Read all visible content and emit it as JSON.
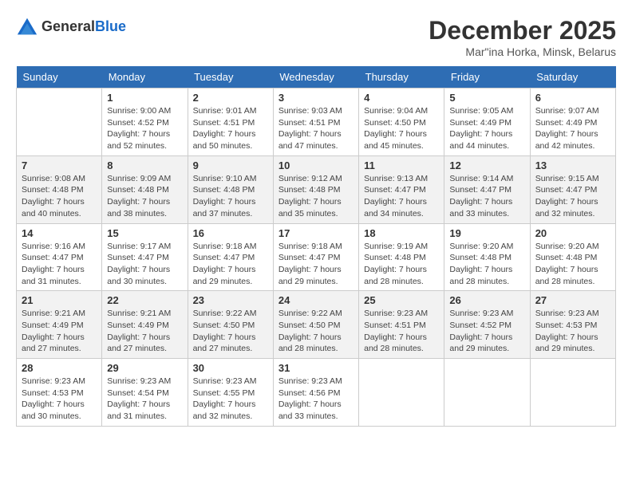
{
  "header": {
    "logo_general": "General",
    "logo_blue": "Blue",
    "title": "December 2025",
    "subtitle": "Mar\"ina Horka, Minsk, Belarus"
  },
  "days_of_week": [
    "Sunday",
    "Monday",
    "Tuesday",
    "Wednesday",
    "Thursday",
    "Friday",
    "Saturday"
  ],
  "weeks": [
    [
      {
        "day": "",
        "info": ""
      },
      {
        "day": "1",
        "info": "Sunrise: 9:00 AM\nSunset: 4:52 PM\nDaylight: 7 hours\nand 52 minutes."
      },
      {
        "day": "2",
        "info": "Sunrise: 9:01 AM\nSunset: 4:51 PM\nDaylight: 7 hours\nand 50 minutes."
      },
      {
        "day": "3",
        "info": "Sunrise: 9:03 AM\nSunset: 4:51 PM\nDaylight: 7 hours\nand 47 minutes."
      },
      {
        "day": "4",
        "info": "Sunrise: 9:04 AM\nSunset: 4:50 PM\nDaylight: 7 hours\nand 45 minutes."
      },
      {
        "day": "5",
        "info": "Sunrise: 9:05 AM\nSunset: 4:49 PM\nDaylight: 7 hours\nand 44 minutes."
      },
      {
        "day": "6",
        "info": "Sunrise: 9:07 AM\nSunset: 4:49 PM\nDaylight: 7 hours\nand 42 minutes."
      }
    ],
    [
      {
        "day": "7",
        "info": "Sunrise: 9:08 AM\nSunset: 4:48 PM\nDaylight: 7 hours\nand 40 minutes."
      },
      {
        "day": "8",
        "info": "Sunrise: 9:09 AM\nSunset: 4:48 PM\nDaylight: 7 hours\nand 38 minutes."
      },
      {
        "day": "9",
        "info": "Sunrise: 9:10 AM\nSunset: 4:48 PM\nDaylight: 7 hours\nand 37 minutes."
      },
      {
        "day": "10",
        "info": "Sunrise: 9:12 AM\nSunset: 4:48 PM\nDaylight: 7 hours\nand 35 minutes."
      },
      {
        "day": "11",
        "info": "Sunrise: 9:13 AM\nSunset: 4:47 PM\nDaylight: 7 hours\nand 34 minutes."
      },
      {
        "day": "12",
        "info": "Sunrise: 9:14 AM\nSunset: 4:47 PM\nDaylight: 7 hours\nand 33 minutes."
      },
      {
        "day": "13",
        "info": "Sunrise: 9:15 AM\nSunset: 4:47 PM\nDaylight: 7 hours\nand 32 minutes."
      }
    ],
    [
      {
        "day": "14",
        "info": "Sunrise: 9:16 AM\nSunset: 4:47 PM\nDaylight: 7 hours\nand 31 minutes."
      },
      {
        "day": "15",
        "info": "Sunrise: 9:17 AM\nSunset: 4:47 PM\nDaylight: 7 hours\nand 30 minutes."
      },
      {
        "day": "16",
        "info": "Sunrise: 9:18 AM\nSunset: 4:47 PM\nDaylight: 7 hours\nand 29 minutes."
      },
      {
        "day": "17",
        "info": "Sunrise: 9:18 AM\nSunset: 4:47 PM\nDaylight: 7 hours\nand 29 minutes."
      },
      {
        "day": "18",
        "info": "Sunrise: 9:19 AM\nSunset: 4:48 PM\nDaylight: 7 hours\nand 28 minutes."
      },
      {
        "day": "19",
        "info": "Sunrise: 9:20 AM\nSunset: 4:48 PM\nDaylight: 7 hours\nand 28 minutes."
      },
      {
        "day": "20",
        "info": "Sunrise: 9:20 AM\nSunset: 4:48 PM\nDaylight: 7 hours\nand 28 minutes."
      }
    ],
    [
      {
        "day": "21",
        "info": "Sunrise: 9:21 AM\nSunset: 4:49 PM\nDaylight: 7 hours\nand 27 minutes."
      },
      {
        "day": "22",
        "info": "Sunrise: 9:21 AM\nSunset: 4:49 PM\nDaylight: 7 hours\nand 27 minutes."
      },
      {
        "day": "23",
        "info": "Sunrise: 9:22 AM\nSunset: 4:50 PM\nDaylight: 7 hours\nand 27 minutes."
      },
      {
        "day": "24",
        "info": "Sunrise: 9:22 AM\nSunset: 4:50 PM\nDaylight: 7 hours\nand 28 minutes."
      },
      {
        "day": "25",
        "info": "Sunrise: 9:23 AM\nSunset: 4:51 PM\nDaylight: 7 hours\nand 28 minutes."
      },
      {
        "day": "26",
        "info": "Sunrise: 9:23 AM\nSunset: 4:52 PM\nDaylight: 7 hours\nand 29 minutes."
      },
      {
        "day": "27",
        "info": "Sunrise: 9:23 AM\nSunset: 4:53 PM\nDaylight: 7 hours\nand 29 minutes."
      }
    ],
    [
      {
        "day": "28",
        "info": "Sunrise: 9:23 AM\nSunset: 4:53 PM\nDaylight: 7 hours\nand 30 minutes."
      },
      {
        "day": "29",
        "info": "Sunrise: 9:23 AM\nSunset: 4:54 PM\nDaylight: 7 hours\nand 31 minutes."
      },
      {
        "day": "30",
        "info": "Sunrise: 9:23 AM\nSunset: 4:55 PM\nDaylight: 7 hours\nand 32 minutes."
      },
      {
        "day": "31",
        "info": "Sunrise: 9:23 AM\nSunset: 4:56 PM\nDaylight: 7 hours\nand 33 minutes."
      },
      {
        "day": "",
        "info": ""
      },
      {
        "day": "",
        "info": ""
      },
      {
        "day": "",
        "info": ""
      }
    ]
  ]
}
